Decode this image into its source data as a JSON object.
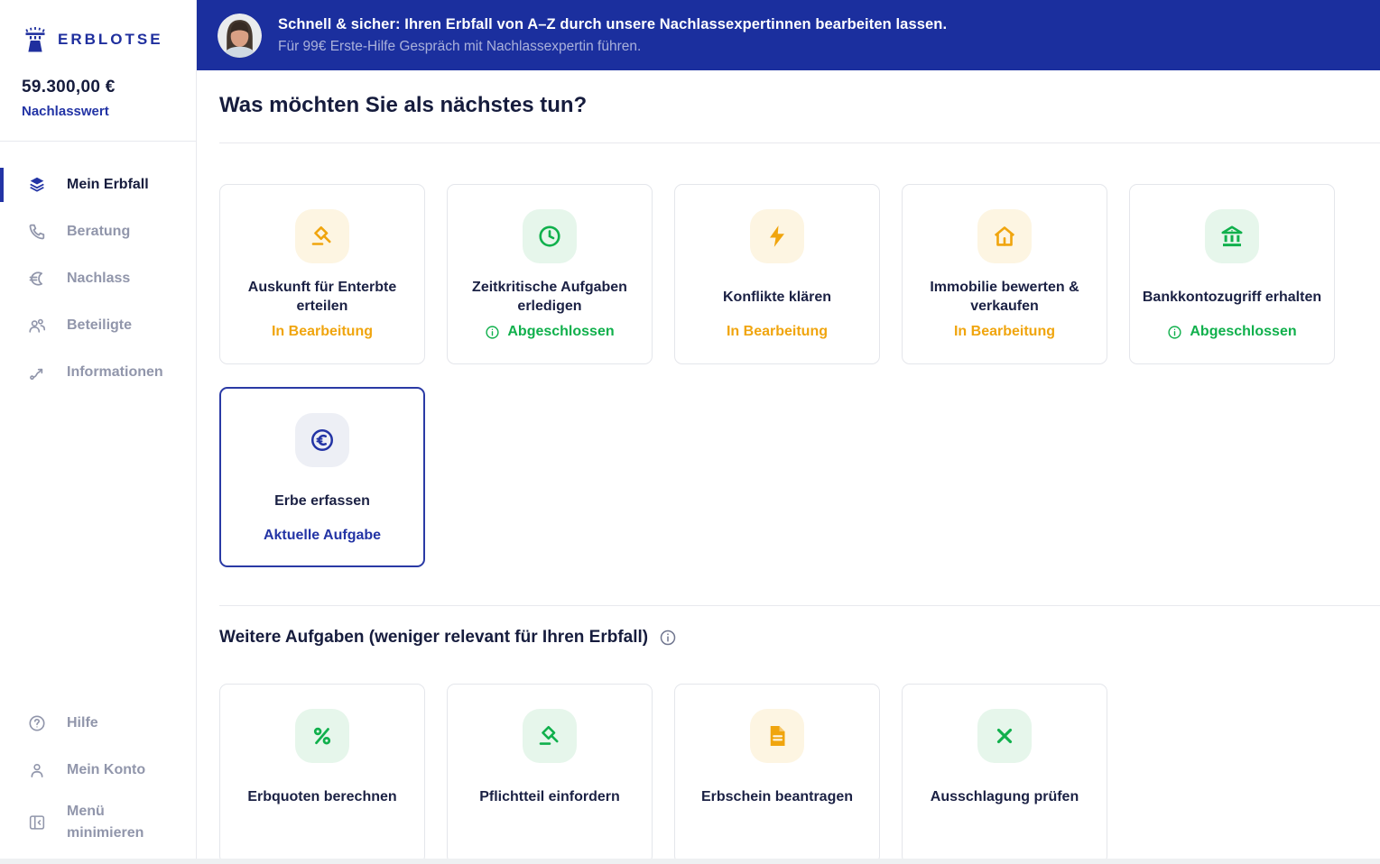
{
  "app": {
    "name": "ERBLOTSE"
  },
  "sidebar": {
    "estate_value": "59.300,00 €",
    "estate_label": "Nachlasswert",
    "nav": [
      {
        "label": "Mein Erbfall",
        "icon": "layers-icon",
        "active": true
      },
      {
        "label": "Beratung",
        "icon": "phone-icon",
        "active": false
      },
      {
        "label": "Nachlass",
        "icon": "euro-icon",
        "active": false
      },
      {
        "label": "Beteiligte",
        "icon": "people-icon",
        "active": false
      },
      {
        "label": "Informationen",
        "icon": "route-icon",
        "active": false
      }
    ],
    "footer": [
      {
        "label": "Hilfe",
        "icon": "help-circle-icon"
      },
      {
        "label": "Mein Konto",
        "icon": "user-icon"
      },
      {
        "label": "Menü minimieren",
        "icon": "collapse-menu-icon"
      }
    ]
  },
  "banner": {
    "line1": "Schnell & sicher: Ihren Erbfall von A–Z durch unsere Nachlassexpertinnen bearbeiten lassen.",
    "line2": "Für 99€ Erste-Hilfe Gespräch mit Nachlassexpertin führen.",
    "avatar": "expert-avatar"
  },
  "main": {
    "heading": "Was möchten Sie als nächstes tun?",
    "tasks": [
      {
        "title": "Auskunft für Enterbte erteilen",
        "status": "In Bearbeitung",
        "state": "in-progress",
        "icon": "gavel-icon",
        "accent": "amber"
      },
      {
        "title": "Zeitkritische Aufgaben erledigen",
        "status": "Abgeschlossen",
        "state": "done",
        "icon": "clock-icon",
        "accent": "green"
      },
      {
        "title": "Konflikte klären",
        "status": "In Bearbeitung",
        "state": "in-progress",
        "icon": "bolt-icon",
        "accent": "amber"
      },
      {
        "title": "Immobilie bewerten & verkaufen",
        "status": "In Bearbeitung",
        "state": "in-progress",
        "icon": "home-icon",
        "accent": "amber"
      },
      {
        "title": "Bankkontozugriff erhalten",
        "status": "Abgeschlossen",
        "state": "done",
        "icon": "bank-icon",
        "accent": "green"
      }
    ],
    "current_task": {
      "title": "Erbe erfassen",
      "status": "Aktuelle Aufgabe",
      "state": "current",
      "icon": "euro-circle-icon",
      "accent": "blue"
    },
    "secondary_heading": "Weitere Aufgaben (weniger relevant für Ihren Erbfall)",
    "secondary_tasks": [
      {
        "title": "Erbquoten berechnen",
        "icon": "percent-icon",
        "accent": "green"
      },
      {
        "title": "Pflichtteil einfordern",
        "icon": "gavel-icon",
        "accent": "green"
      },
      {
        "title": "Erbschein beantragen",
        "icon": "document-icon",
        "accent": "amber"
      },
      {
        "title": "Ausschlagung prüfen",
        "icon": "x-icon",
        "accent": "green"
      }
    ]
  },
  "colors": {
    "banner_blue": "#1b2f9e",
    "accent_blue": "#2334a5",
    "navy_text": "#171d40",
    "muted_gray": "#9196ab",
    "amber": "#f0a50e",
    "amber_bg": "#fdf5e2",
    "green": "#10b04c",
    "green_bg": "#e6f6eb",
    "blue_bg": "#edeff5",
    "card_border": "#e4e6eb"
  }
}
